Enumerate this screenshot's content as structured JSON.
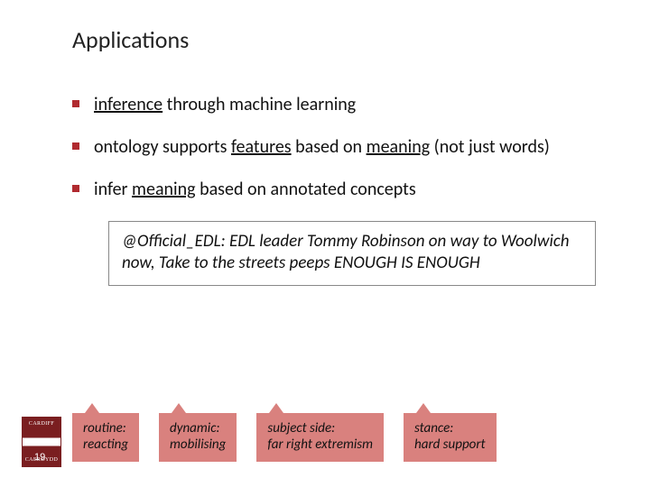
{
  "title": "Applications",
  "bullets": [
    {
      "pre": "",
      "u1": "inference",
      "mid1": " through machine learning",
      "u2": "",
      "mid2": "",
      "u3": "",
      "post": ""
    },
    {
      "pre": "ontology supports ",
      "u1": "features",
      "mid1": " based on ",
      "u2": "meaning",
      "mid2": " (not just words)",
      "u3": "",
      "post": ""
    },
    {
      "pre": "infer ",
      "u1": "meaning",
      "mid1": " based on annotated concepts",
      "u2": "",
      "mid2": "",
      "u3": "",
      "post": ""
    }
  ],
  "tweet": "@Official_EDL: EDL leader Tommy Robinson on way to Woolwich now, Take to the streets peeps ENOUGH IS ENOUGH",
  "tags": [
    {
      "k": "routine:",
      "v": "reacting"
    },
    {
      "k": "dynamic:",
      "v": "mobilising"
    },
    {
      "k": "subject side:",
      "v": "far right extremism"
    },
    {
      "k": "stance:",
      "v": "hard support"
    }
  ],
  "logo": {
    "line1": "CARDIFF",
    "line2": "CAERDYDD"
  },
  "page": "19"
}
